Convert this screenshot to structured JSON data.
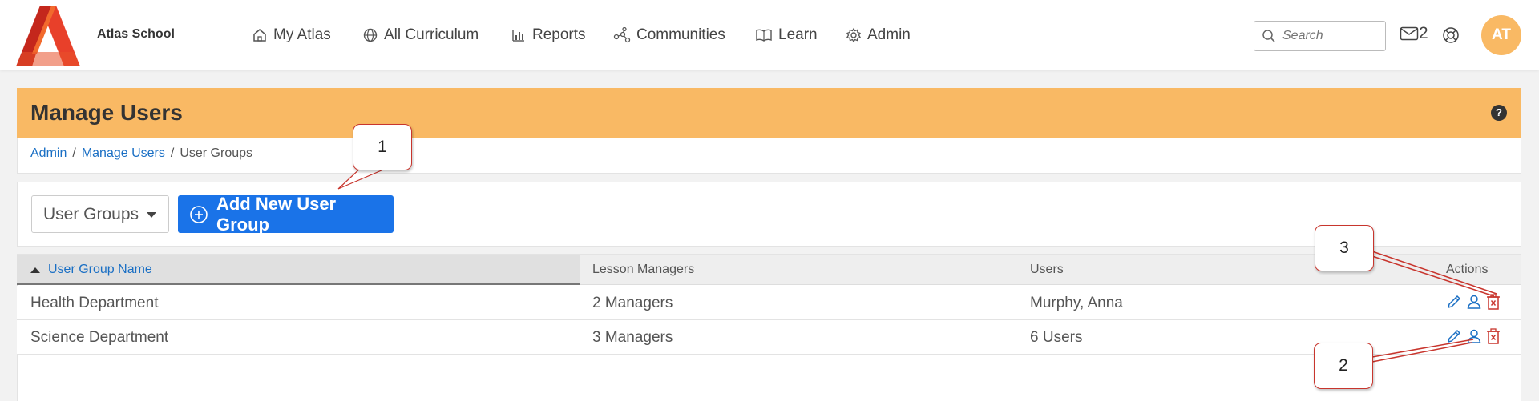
{
  "nav": {
    "school_name": "Atlas School",
    "items": [
      {
        "label": "My Atlas",
        "icon": "home-icon"
      },
      {
        "label": "All Curriculum",
        "icon": "globe-icon"
      },
      {
        "label": "Reports",
        "icon": "bar-chart-icon"
      },
      {
        "label": "Communities",
        "icon": "network-icon"
      },
      {
        "label": "Learn",
        "icon": "book-icon"
      },
      {
        "label": "Admin",
        "icon": "gear-icon"
      }
    ],
    "search_placeholder": "Search",
    "message_count": "2",
    "avatar_initials": "AT"
  },
  "page": {
    "title": "Manage Users",
    "help": "?",
    "breadcrumb": [
      {
        "label": "Admin"
      },
      {
        "label": "Manage Users"
      },
      {
        "label": "User Groups"
      }
    ],
    "separator": "/"
  },
  "toolbar": {
    "view_select": "User Groups",
    "add_button": "Add New User Group"
  },
  "table": {
    "columns": [
      "User Group Name",
      "Lesson Managers",
      "Users",
      "Actions"
    ],
    "rows": [
      {
        "name": "Health Department",
        "managers": "2 Managers",
        "users": "Murphy, Anna"
      },
      {
        "name": "Science Department",
        "managers": "3 Managers",
        "users": "6 Users"
      }
    ]
  },
  "callouts": [
    "1",
    "2",
    "3"
  ],
  "colors": {
    "accent_orange": "#f9b964",
    "primary_blue": "#1a73e8",
    "link_blue": "#1a6fc4",
    "delete_red": "#c8352d"
  }
}
